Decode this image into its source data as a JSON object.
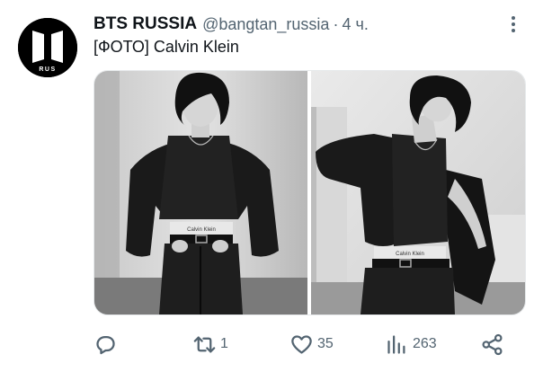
{
  "tweet": {
    "author_name": "BTS RUSSIA",
    "author_handle": "@bangtan_russia",
    "separator": "·",
    "time": "4 ч.",
    "text": "[ФОТО] Calvin Klein",
    "avatar_text": "RUS",
    "photos": [
      {
        "name": "photo-1",
        "waistband_text": "Calvin Klein"
      },
      {
        "name": "photo-2",
        "waistband_text": "Calvin Klein"
      }
    ]
  },
  "actions": {
    "reply": {
      "icon": "reply-icon",
      "count": ""
    },
    "retweet": {
      "icon": "retweet-icon",
      "count": "1"
    },
    "like": {
      "icon": "heart-icon",
      "count": "35"
    },
    "views": {
      "icon": "views-icon",
      "count": "263"
    },
    "share": {
      "icon": "share-icon",
      "count": ""
    }
  },
  "colors": {
    "text_primary": "#0f1419",
    "text_secondary": "#536471",
    "background": "#ffffff",
    "avatar_bg": "#000000"
  }
}
